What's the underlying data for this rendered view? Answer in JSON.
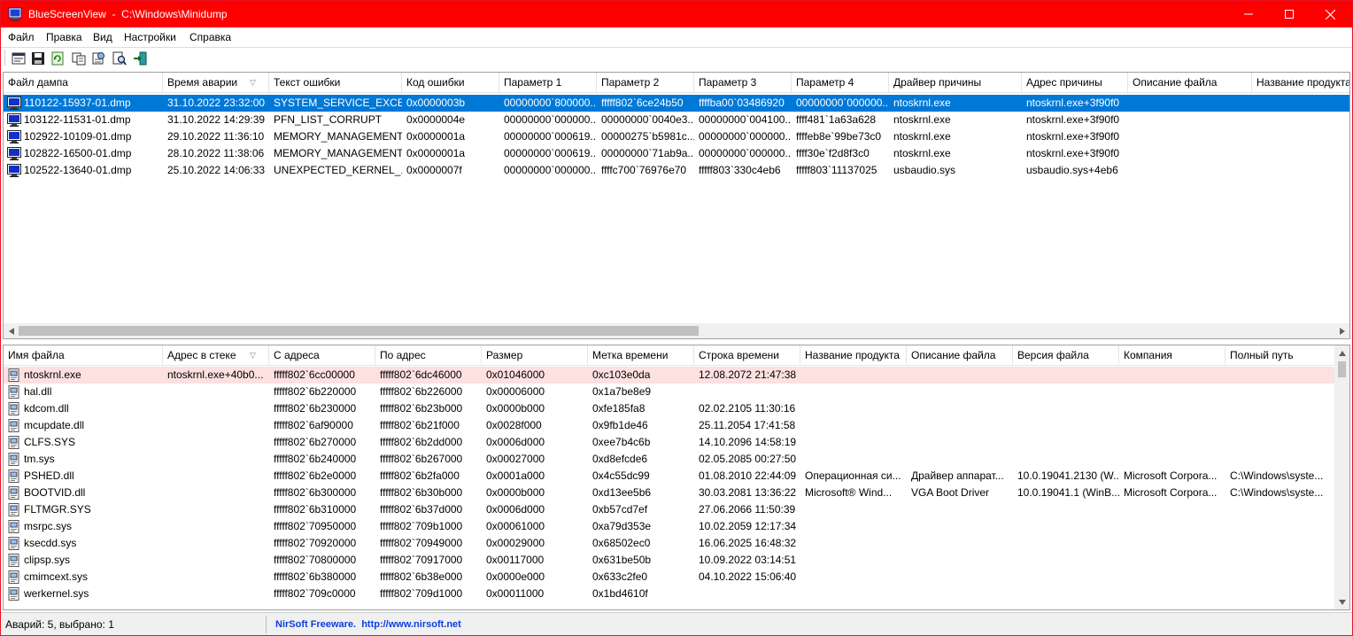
{
  "window": {
    "title": "BlueScreenView  -  C:\\Windows\\Minidump"
  },
  "menu": [
    "Файл",
    "Правка",
    "Вид",
    "Настройки",
    "Справка"
  ],
  "toolbar_icons": [
    "properties-icon",
    "save-icon",
    "refresh-icon",
    "copy-icon",
    "html-report-icon",
    "find-icon",
    "exit-icon"
  ],
  "top_table": {
    "columns": [
      "Файл дампа",
      "Время аварии",
      "Текст ошибки",
      "Код ошибки",
      "Параметр 1",
      "Параметр 2",
      "Параметр 3",
      "Параметр 4",
      "Драйвер причины",
      "Адрес причины",
      "Описание файла",
      "Название продукта"
    ],
    "rows": [
      [
        "110122-15937-01.dmp",
        "31.10.2022 23:32:00",
        "SYSTEM_SERVICE_EXCEP...",
        "0x0000003b",
        "00000000`800000...",
        "fffff802`6ce24b50",
        "ffffba00`03486920",
        "00000000`000000...",
        "ntoskrnl.exe",
        "ntoskrnl.exe+3f90f0"
      ],
      [
        "103122-11531-01.dmp",
        "31.10.2022 14:29:39",
        "PFN_LIST_CORRUPT",
        "0x0000004e",
        "00000000`000000...",
        "00000000`0040e3...",
        "00000000`004100...",
        "ffff481`1a63a628",
        "ntoskrnl.exe",
        "ntoskrnl.exe+3f90f0"
      ],
      [
        "102922-10109-01.dmp",
        "29.10.2022 11:36:10",
        "MEMORY_MANAGEMENT",
        "0x0000001a",
        "00000000`000619...",
        "00000275`b5981c...",
        "00000000`000000...",
        "ffffeb8e`99be73c0",
        "ntoskrnl.exe",
        "ntoskrnl.exe+3f90f0"
      ],
      [
        "102822-16500-01.dmp",
        "28.10.2022 11:38:06",
        "MEMORY_MANAGEMENT",
        "0x0000001a",
        "00000000`000619...",
        "00000000`71ab9a...",
        "00000000`000000...",
        "ffff30e`f2d8f3c0",
        "ntoskrnl.exe",
        "ntoskrnl.exe+3f90f0"
      ],
      [
        "102522-13640-01.dmp",
        "25.10.2022 14:06:33",
        "UNEXPECTED_KERNEL_...",
        "0x0000007f",
        "00000000`000000...",
        "ffffc700`76976e70",
        "fffff803`330c4eb6",
        "fffff803`11137025",
        "usbaudio.sys",
        "usbaudio.sys+4eb6"
      ]
    ]
  },
  "bottom_table": {
    "columns": [
      "Имя файла",
      "Адрес в стеке",
      "С адреса",
      "По адрес",
      "Размер",
      "Метка времени",
      "Строка времени",
      "Название продукта",
      "Описание файла",
      "Версия файла",
      "Компания",
      "Полный путь"
    ],
    "rows": [
      [
        "ntoskrnl.exe",
        "ntoskrnl.exe+40b0...",
        "fffff802`6cc00000",
        "fffff802`6dc46000",
        "0x01046000",
        "0xc103e0da",
        "12.08.2072 21:47:38",
        "",
        "",
        "",
        "",
        ""
      ],
      [
        "hal.dll",
        "",
        "fffff802`6b220000",
        "fffff802`6b226000",
        "0x00006000",
        "0x1a7be8e9",
        "",
        "",
        "",
        "",
        "",
        ""
      ],
      [
        "kdcom.dll",
        "",
        "fffff802`6b230000",
        "fffff802`6b23b000",
        "0x0000b000",
        "0xfe185fa8",
        "02.02.2105 11:30:16",
        "",
        "",
        "",
        "",
        ""
      ],
      [
        "mcupdate.dll",
        "",
        "fffff802`6af90000",
        "fffff802`6b21f000",
        "0x0028f000",
        "0x9fb1de46",
        "25.11.2054 17:41:58",
        "",
        "",
        "",
        "",
        ""
      ],
      [
        "CLFS.SYS",
        "",
        "fffff802`6b270000",
        "fffff802`6b2dd000",
        "0x0006d000",
        "0xee7b4c6b",
        "14.10.2096 14:58:19",
        "",
        "",
        "",
        "",
        ""
      ],
      [
        "tm.sys",
        "",
        "fffff802`6b240000",
        "fffff802`6b267000",
        "0x00027000",
        "0xd8efcde6",
        "02.05.2085 00:27:50",
        "",
        "",
        "",
        "",
        ""
      ],
      [
        "PSHED.dll",
        "",
        "fffff802`6b2e0000",
        "fffff802`6b2fa000",
        "0x0001a000",
        "0x4c55dc99",
        "01.08.2010 22:44:09",
        "Операционная си...",
        "Драйвер аппарат...",
        "10.0.19041.2130 (W...",
        "Microsoft Corpora...",
        "C:\\Windows\\syste..."
      ],
      [
        "BOOTVID.dll",
        "",
        "fffff802`6b300000",
        "fffff802`6b30b000",
        "0x0000b000",
        "0xd13ee5b6",
        "30.03.2081 13:36:22",
        "Microsoft® Wind...",
        "VGA Boot Driver",
        "10.0.19041.1 (WinB...",
        "Microsoft Corpora...",
        "C:\\Windows\\syste..."
      ],
      [
        "FLTMGR.SYS",
        "",
        "fffff802`6b310000",
        "fffff802`6b37d000",
        "0x0006d000",
        "0xb57cd7ef",
        "27.06.2066 11:50:39",
        "",
        "",
        "",
        "",
        ""
      ],
      [
        "msrpc.sys",
        "",
        "fffff802`70950000",
        "fffff802`709b1000",
        "0x00061000",
        "0xa79d353e",
        "10.02.2059 12:17:34",
        "",
        "",
        "",
        "",
        ""
      ],
      [
        "ksecdd.sys",
        "",
        "fffff802`70920000",
        "fffff802`70949000",
        "0x00029000",
        "0x68502ec0",
        "16.06.2025 16:48:32",
        "",
        "",
        "",
        "",
        ""
      ],
      [
        "clipsp.sys",
        "",
        "fffff802`70800000",
        "fffff802`70917000",
        "0x00117000",
        "0x631be50b",
        "10.09.2022 03:14:51",
        "",
        "",
        "",
        "",
        ""
      ],
      [
        "cmimcext.sys",
        "",
        "fffff802`6b380000",
        "fffff802`6b38e000",
        "0x0000e000",
        "0x633c2fe0",
        "04.10.2022 15:06:40",
        "",
        "",
        "",
        "",
        ""
      ],
      [
        "werkernel.sys",
        "",
        "fffff802`709c0000",
        "fffff802`709d1000",
        "0x00011000",
        "0x1bd4610f",
        "",
        "",
        "",
        "",
        "",
        ""
      ]
    ]
  },
  "status": {
    "left": "Аварий: 5, выбрано: 1",
    "right": "NirSoft Freeware.  http://www.nirsoft.net"
  }
}
